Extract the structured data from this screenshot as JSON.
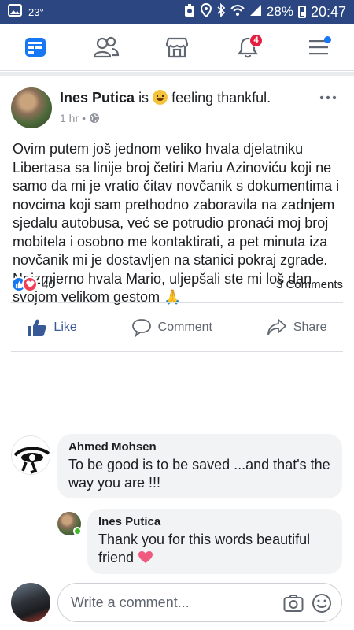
{
  "status_bar": {
    "temperature": "23°",
    "battery": "28%",
    "time": "20:47"
  },
  "nav": {
    "notifications_badge": "4"
  },
  "post": {
    "author": "Ines Putica",
    "is_text": "is",
    "activity": "feeling thankful.",
    "time": "1 hr",
    "separator": "•",
    "body": "Ovim putem još jednom veliko hvala djelatniku Libertasa sa linije broj četiri Mariu Azinoviću koji ne samo da mi je vratio čitav novčanik s dokumentima i novcima koji sam prethodno zaboravila na zadnjem sjedalu autobusa, već se potrudio pronaći moj broj mobitela i osobno me kontaktirati, a pet minuta iza novčanik mi je dostavljen na stanici pokraj zgrade. Neizmjerno hvala Mario, uljepšali ste mi loš dan svojom velikom gestom",
    "emoji": "🙏",
    "reaction_count": "40",
    "comments_count": "3 Comments"
  },
  "actions": {
    "like": "Like",
    "comment": "Comment",
    "share": "Share"
  },
  "comments": [
    {
      "name": "Ahmed Mohsen",
      "text": "To be good is to be saved ...and that's the way you are !!!"
    },
    {
      "name": "Ines Putica",
      "text": "Thank you for this words beautiful friend"
    }
  ],
  "composer": {
    "placeholder": "Write a comment..."
  },
  "colors": {
    "status_bar": "#2b4680",
    "fb_blue": "#1877f2",
    "like_blue": "#385898",
    "badge_red": "#e41e3f",
    "love_red": "#f33e58"
  }
}
